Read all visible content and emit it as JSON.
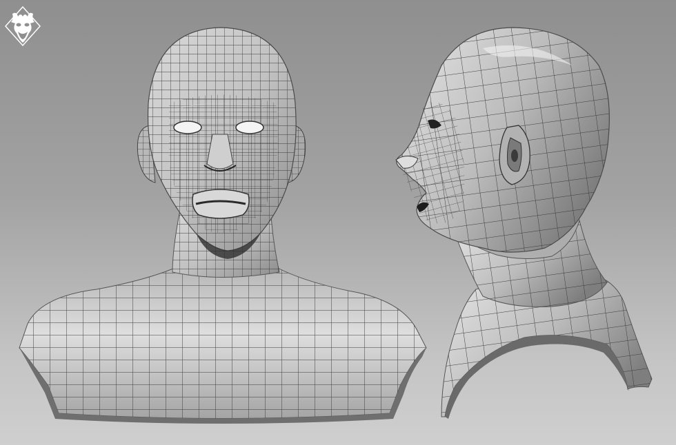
{
  "scene": {
    "background_top": "#8f8f8f",
    "background_bottom": "#cfcfcf",
    "mesh_fill": "#bdbdbd",
    "mesh_highlight": "#e4e4e4",
    "mesh_shadow": "#7d7d7d",
    "wire_color": "#3a3a3a"
  },
  "views": [
    {
      "name": "front-view"
    },
    {
      "name": "side-view"
    }
  ],
  "logo": {
    "icon": "studio-mask-logo-icon",
    "color": "#ffffff"
  }
}
